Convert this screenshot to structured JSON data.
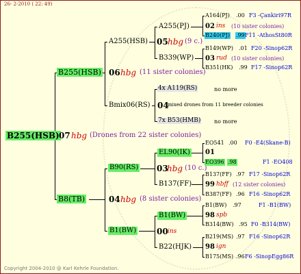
{
  "header": "26-  2-2010 ( 22: 49)",
  "footer": "Copyright 2004-2010 @ Karl Kehrle Foundation.",
  "root": {
    "name": "B255(HSB)",
    "num": "07",
    "tag": "hbg",
    "note": "(Drones from 22 sister colonies)"
  },
  "sire": {
    "name": "B255(HSB)",
    "num": "06",
    "tag": "hbg",
    "note": "(11 sister colonies)",
    "sire": {
      "name": "A255(HSB)",
      "num": "05",
      "tag": "hbg",
      "note": "(9 c.)",
      "sire": {
        "name": "A255(PJ)",
        "a": {
          "name": "A164(PJ)",
          "val": ".00",
          "right": "F3 -Çankiri97R"
        },
        "mid": {
          "num": "02",
          "tag": "ins",
          "note": "(10 sister colonies)"
        },
        "b": {
          "name": "B240(PJ)",
          "val": ".99",
          "right": "F11 -AthosSt80R"
        }
      },
      "dam": {
        "name": "B339(WP)",
        "a": {
          "name": "B149(WP)",
          "val": ".01",
          "right": "F20 -Sinop62R"
        },
        "mid": {
          "num": "03",
          "tag": "rud",
          "note": "(10 sister colonies)"
        },
        "b": {
          "name": "B351(HK)",
          "val": ".99",
          "right": "F17 -Sinop62R"
        }
      }
    },
    "dam": {
      "name": "Bmix06(RS)",
      "sire": {
        "name": "4x A119(RS)",
        "note": "no more"
      },
      "mid": {
        "num": "04",
        "note": "mixed drones from 11 breeder colonies"
      },
      "dam": {
        "name": "7x B53(HMB)",
        "note": "no more"
      }
    }
  },
  "dam": {
    "name": "B8(TB)",
    "num": "04",
    "tag": "hbg",
    "note": "(8 sister colonies)",
    "sire": {
      "name": "B90(RS)",
      "num": "03",
      "tag": "hbg",
      "note": "(10 c.)",
      "sire": {
        "name": "EL90(IK)",
        "a": {
          "name": "EO541",
          "val": ".00",
          "right": "F0 -E4(Skane-B)"
        },
        "mid": {
          "num": "01",
          "tag": "",
          "note": ""
        },
        "b": {
          "name": "EO396",
          "val": ".98",
          "right": "F1 -EO408"
        }
      },
      "dam": {
        "name": "B137(FF)",
        "a": {
          "name": "B137(FF)",
          "val": ".97",
          "right": "F17 -Sinop62R"
        },
        "mid": {
          "num": "99",
          "tag": "hbff",
          "note": "(12 sister colonies)"
        },
        "b": {
          "name": "B387(FF)",
          "val": ".96",
          "right": "F16 -Sinop62R"
        }
      }
    },
    "dam": {
      "name": "B1(BW)",
      "num": "00",
      "tag": "ins",
      "note": "",
      "sire": {
        "name": "B1(BW)",
        "a": {
          "name": "B1(BW)",
          "val": ".97",
          "right": "F1 -B1(BW)"
        },
        "mid": {
          "num": "98",
          "tag": "spb",
          "note": ""
        },
        "b": {
          "name": "B314(BW)",
          "val": ".95",
          "right": "F0 -B314(BW)"
        }
      },
      "dam": {
        "name": "B22(HJK)",
        "a": {
          "name": "B219(MS)",
          "val": ".97",
          "right": "F16 -Sinop62R"
        },
        "mid": {
          "num": "98",
          "tag": "ign",
          "note": ""
        },
        "b": {
          "name": "B175(MS)",
          "val": ".96",
          "right": "F6 -SinopEgg86R"
        }
      }
    }
  },
  "colors": {
    "green": "#66ee66",
    "cyan": "#33ccee",
    "red": "#cc0000",
    "purple": "#7a1fa0",
    "blue": "#0000cc"
  }
}
